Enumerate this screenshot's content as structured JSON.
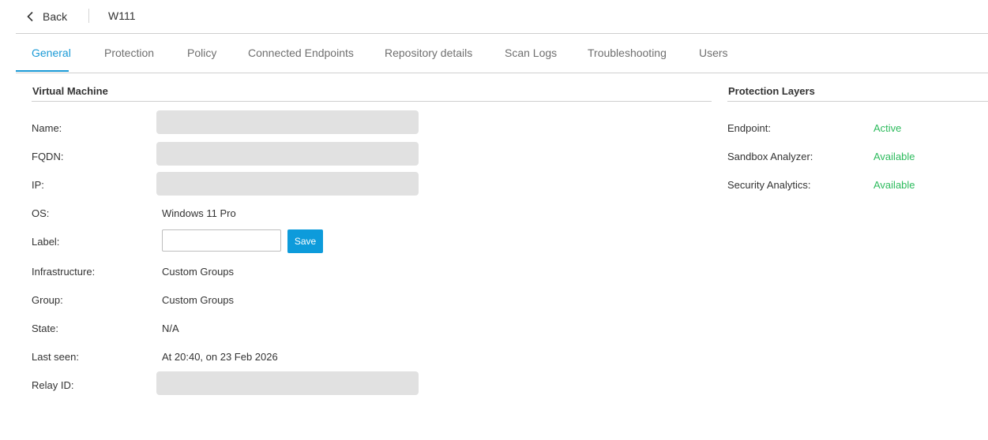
{
  "header": {
    "back_label": "Back",
    "title": "W111"
  },
  "tabs": [
    {
      "label": "General",
      "active": true
    },
    {
      "label": "Protection",
      "active": false
    },
    {
      "label": "Policy",
      "active": false
    },
    {
      "label": "Connected Endpoints",
      "active": false
    },
    {
      "label": "Repository details",
      "active": false
    },
    {
      "label": "Scan Logs",
      "active": false
    },
    {
      "label": "Troubleshooting",
      "active": false
    },
    {
      "label": "Users",
      "active": false
    }
  ],
  "virtual_machine": {
    "title": "Virtual Machine",
    "fields": {
      "name": {
        "label": "Name:"
      },
      "fqdn": {
        "label": "FQDN:"
      },
      "ip": {
        "label": "IP:"
      },
      "os": {
        "label": "OS:",
        "value": "Windows 11 Pro"
      },
      "label": {
        "label": "Label:",
        "value": "",
        "placeholder": "",
        "save_label": "Save"
      },
      "infrastructure": {
        "label": "Infrastructure:",
        "value": "Custom Groups"
      },
      "group": {
        "label": "Group:",
        "value": "Custom Groups"
      },
      "state": {
        "label": "State:",
        "value": "N/A"
      },
      "last_seen": {
        "label": "Last seen:",
        "value": "At 20:40, on 23 Feb 2026"
      },
      "relay_id": {
        "label": "Relay ID:"
      }
    }
  },
  "protection_layers": {
    "title": "Protection Layers",
    "items": [
      {
        "label": "Endpoint:",
        "value": "Active"
      },
      {
        "label": "Sandbox Analyzer:",
        "value": "Available"
      },
      {
        "label": "Security Analytics:",
        "value": "Available"
      }
    ]
  },
  "colors": {
    "accent": "#1a9ad6",
    "status_green": "#2dbb5d",
    "redacted": "#e1e1e1"
  },
  "icons": {
    "back": "chevron-left-icon"
  }
}
